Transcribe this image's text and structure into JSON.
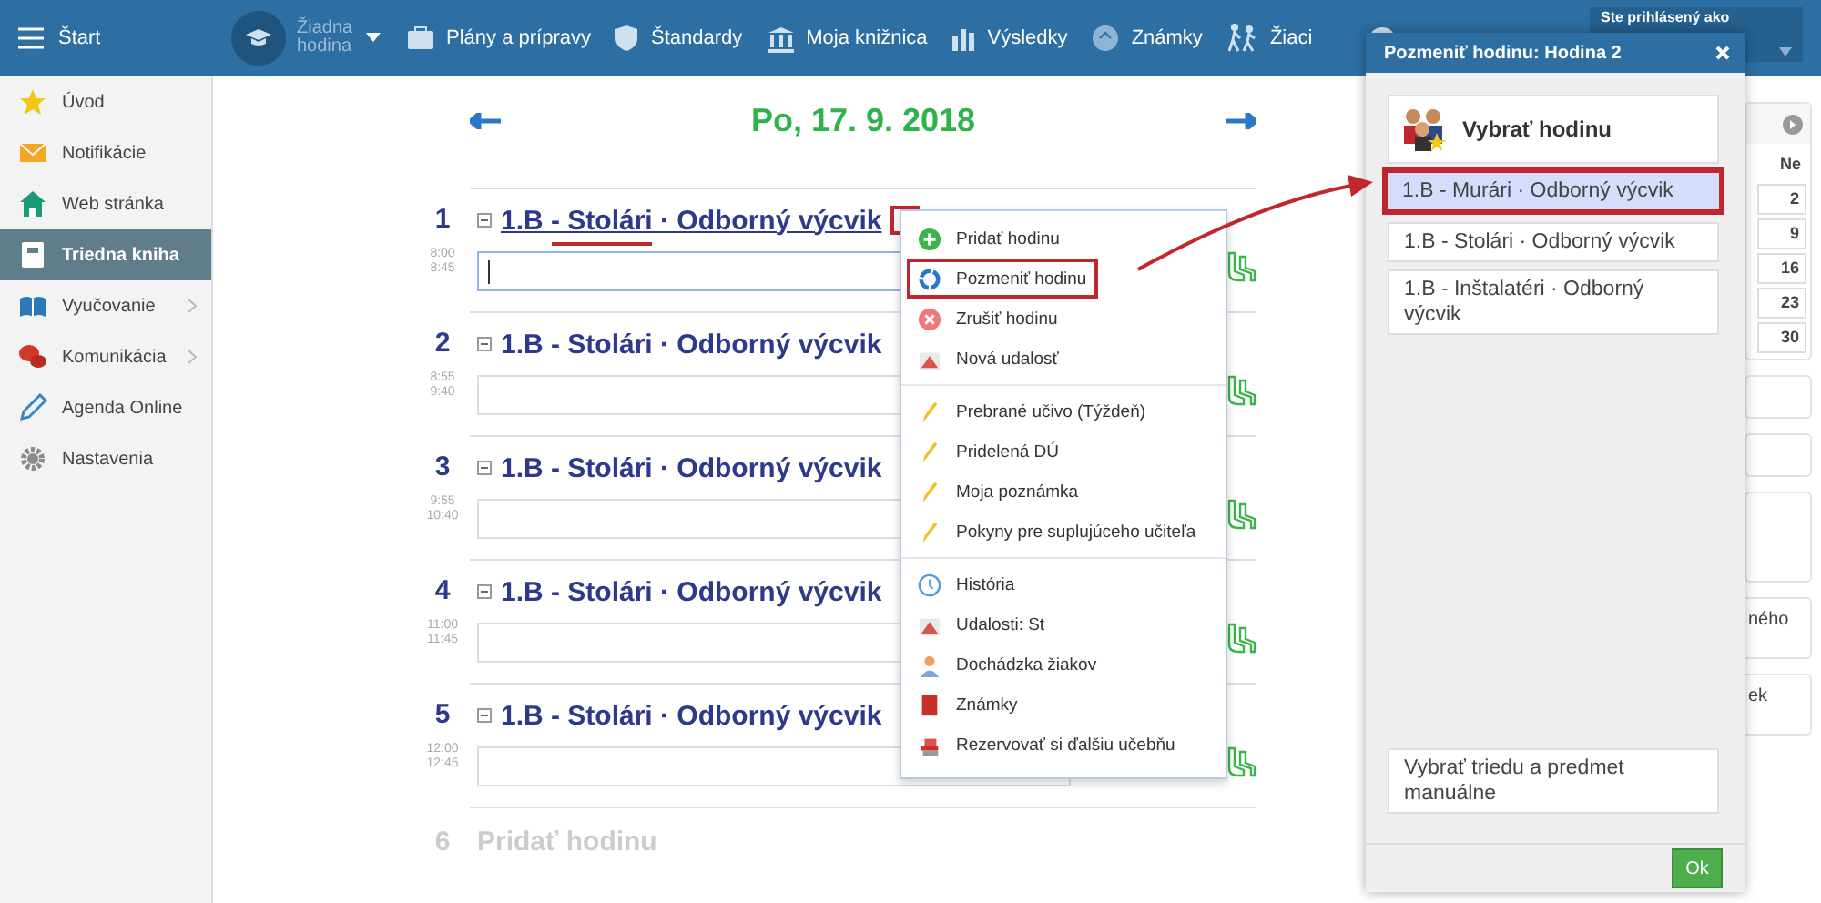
{
  "topbar": {
    "menu_label": "Štart",
    "lesson_selector": "Žiadna hodina",
    "nav": [
      {
        "label": "Plány a prípravy"
      },
      {
        "label": "Štandardy"
      },
      {
        "label": "Moja knižnica"
      },
      {
        "label": "Výsledky"
      },
      {
        "label": "Známky"
      },
      {
        "label": "Žiaci"
      }
    ],
    "login_label": "Ste prihlásený ako"
  },
  "sidebar": {
    "items": [
      {
        "label": "Úvod",
        "selected": false,
        "has_submenu": false
      },
      {
        "label": "Notifikácie",
        "selected": false,
        "has_submenu": false
      },
      {
        "label": "Web stránka",
        "selected": false,
        "has_submenu": false
      },
      {
        "label": "Triedna kniha",
        "selected": true,
        "has_submenu": false
      },
      {
        "label": "Vyučovanie",
        "selected": false,
        "has_submenu": true
      },
      {
        "label": "Komunikácia",
        "selected": false,
        "has_submenu": true
      },
      {
        "label": "Agenda Online",
        "selected": false,
        "has_submenu": false
      },
      {
        "label": "Nastavenia",
        "selected": false,
        "has_submenu": false
      }
    ]
  },
  "day": {
    "date": "Po, 17. 9. 2018"
  },
  "lessons": [
    {
      "number": "1",
      "start": "8:00",
      "end": "8:45",
      "title": "1.B - Stolári · Odborný výcvik",
      "focused": true,
      "marked": true
    },
    {
      "number": "2",
      "start": "8:55",
      "end": "9:40",
      "title": "1.B - Stolári · Odborný výcvik",
      "focused": false,
      "marked": false
    },
    {
      "number": "3",
      "start": "9:55",
      "end": "10:40",
      "title": "1.B - Stolári · Odborný výcvik",
      "focused": false,
      "marked": false
    },
    {
      "number": "4",
      "start": "11:00",
      "end": "11:45",
      "title": "1.B - Stolári · Odborný výcvik",
      "focused": false,
      "marked": false
    },
    {
      "number": "5",
      "start": "12:00",
      "end": "12:45",
      "title": "1.B - Stolári · Odborný výcvik",
      "focused": false,
      "marked": false
    }
  ],
  "add_lesson": {
    "number": "6",
    "label": "Pridať hodinu"
  },
  "context_menu": {
    "groups": [
      [
        {
          "label": "Pridať hodinu",
          "highlighted": false
        },
        {
          "label": "Pozmeniť hodinu",
          "highlighted": true
        },
        {
          "label": "Zrušiť hodinu",
          "highlighted": false
        },
        {
          "label": "Nová udalosť",
          "highlighted": false
        }
      ],
      [
        {
          "label": "Prebrané učivo (Týždeň)",
          "highlighted": false
        },
        {
          "label": "Pridelená DÚ",
          "highlighted": false
        },
        {
          "label": "Moja poznámka",
          "highlighted": false
        },
        {
          "label": "Pokyny pre suplujúceho učiteľa",
          "highlighted": false
        }
      ],
      [
        {
          "label": "História",
          "highlighted": false
        },
        {
          "label": "Udalosti: St",
          "highlighted": false
        },
        {
          "label": "Dochádzka žiakov",
          "highlighted": false
        },
        {
          "label": "Známky",
          "highlighted": false
        },
        {
          "label": "Rezervovať si ďalšiu učebňu",
          "highlighted": false
        }
      ]
    ]
  },
  "calendar": {
    "header": "Ne",
    "days": [
      "2",
      "9",
      "16",
      "23",
      "30"
    ]
  },
  "side_card_texts": [
    "ného",
    "ek"
  ],
  "dialog": {
    "title": "Pozmeniť hodinu: Hodina 2",
    "heading": "Vybrať hodinu",
    "options": [
      {
        "label": "1.B - Murári · Odborný výcvik",
        "selected": true
      },
      {
        "label": "1.B - Stolári · Odborný výcvik",
        "selected": false
      },
      {
        "label": "1.B - Inštalatéri · Odborný výcvik",
        "selected": false
      }
    ],
    "manual_option": "Vybrať triedu a predmet manuálne",
    "ok_label": "Ok"
  }
}
